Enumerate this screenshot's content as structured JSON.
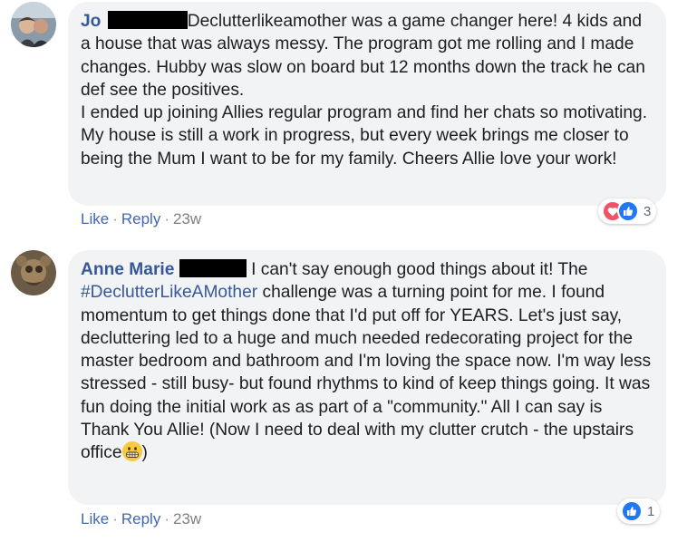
{
  "comments": [
    {
      "author": "Jo",
      "text": "Declutterlikeamother was a game changer here! 4 kids and a house that was always messy. The program got me rolling and I made changes. Hubby was slow on board but 12 months down the track he can def see the positives.",
      "text2": "I ended up joining Allies regular program and find her chats so motivating. My house is still a work in progress, but every week brings me closer to being the Mum I want to be for my family. Cheers Allie love your work!",
      "like_label": "Like",
      "reply_label": "Reply",
      "separator": "·",
      "time": "23w",
      "reaction_count": "3",
      "reactions": [
        "love-icon",
        "like-icon"
      ]
    },
    {
      "author": "Anne Marie",
      "text_before": "I can't say enough good things about it! The",
      "hashtag": "#DeclutterLikeAMother",
      "text_after": "challenge was a turning point for me. I found momentum to get things done that I'd put off for YEARS. Let's just say, decluttering led to a huge and much needed redecorating project for the master bedroom and bathroom and I'm loving the space now. I'm way less stressed - still busy- but found rhythms to kind of keep things going. It was fun doing the initial work as as part of a \"community.\" All I can say is Thank You Allie! (Now I need to deal with my clutter crutch - the upstairs office",
      "text_end": ")",
      "emoji": "grimacing-face-icon",
      "like_label": "Like",
      "reply_label": "Reply",
      "separator": "·",
      "time": "23w",
      "reaction_count": "1",
      "reactions": [
        "like-icon"
      ]
    }
  ],
  "colors": {
    "bubble": "#f2f3f5",
    "author": "#365899",
    "link": "#4267b2",
    "love": "#f25268",
    "like": "#2078f4"
  }
}
